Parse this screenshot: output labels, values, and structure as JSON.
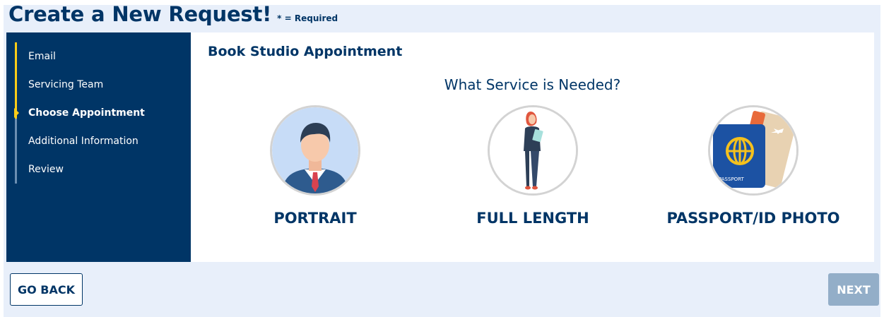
{
  "header": {
    "title": "Create a New Request!",
    "required_note": "* = Required"
  },
  "sidebar": {
    "steps": [
      {
        "label": "Email",
        "active": false
      },
      {
        "label": "Servicing Team",
        "active": false
      },
      {
        "label": "Choose Appointment",
        "active": true
      },
      {
        "label": "Additional Information",
        "active": false
      },
      {
        "label": "Review",
        "active": false
      }
    ]
  },
  "main": {
    "section_title": "Book Studio Appointment",
    "question": "What Service is Needed?",
    "options": [
      {
        "label": "PORTRAIT",
        "icon": "portrait-icon"
      },
      {
        "label": "FULL LENGTH",
        "icon": "full-length-icon"
      },
      {
        "label": "PASSPORT/ID PHOTO",
        "icon": "passport-icon",
        "passport_text": "PASSPORT"
      }
    ]
  },
  "footer": {
    "back_label": "GO BACK",
    "next_label": "NEXT"
  },
  "colors": {
    "navy": "#003566",
    "accent_yellow": "#ffcd17",
    "background": "#e8effa",
    "next_disabled": "#93aec8"
  }
}
